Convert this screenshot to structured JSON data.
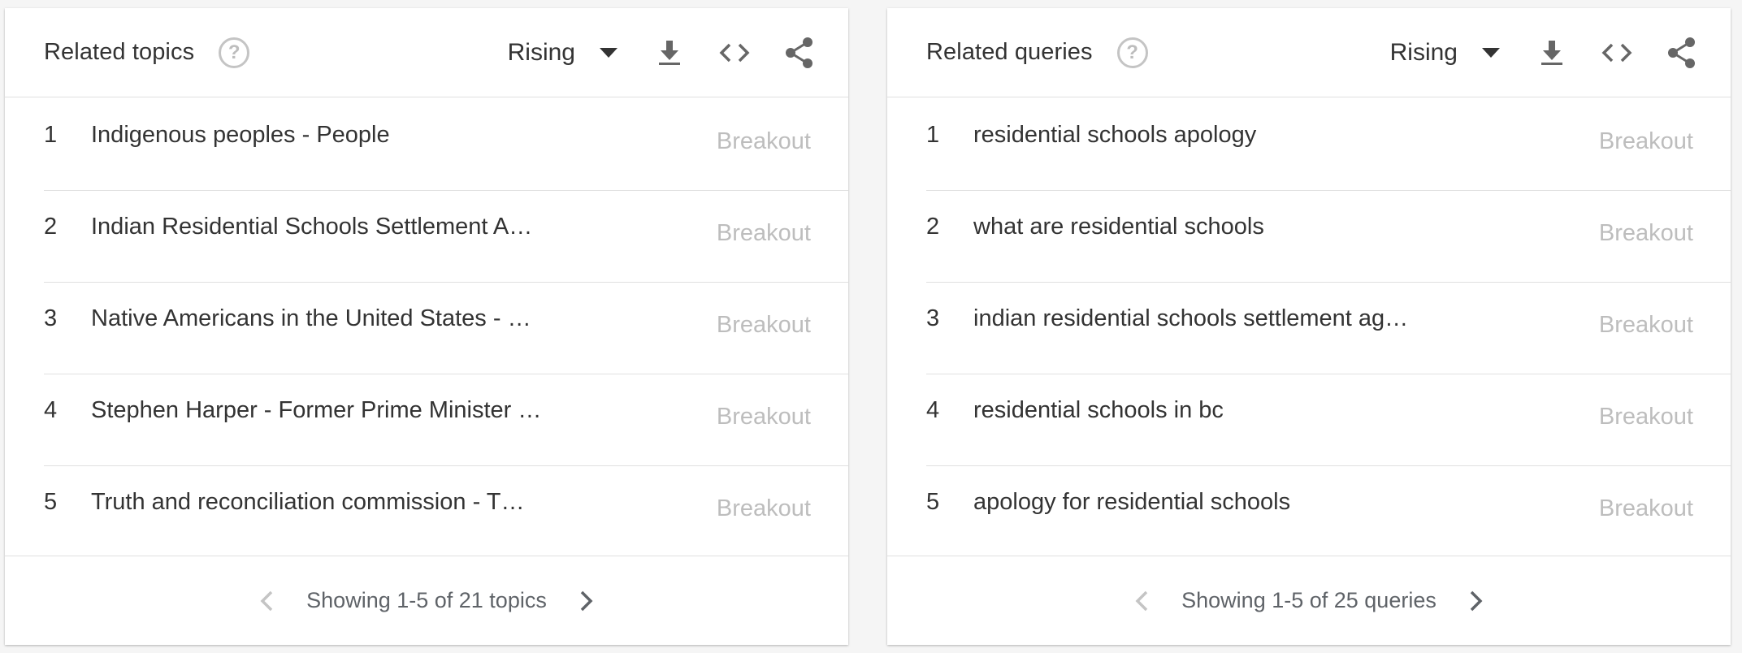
{
  "colors": {
    "icon": "#666666",
    "muted": "#bdbdbd",
    "text": "#333333",
    "divider": "#e0e0e0"
  },
  "topics": {
    "title": "Related topics",
    "help_icon": "help-circle-icon",
    "filter": "Rising",
    "icons": [
      "download-icon",
      "embed-code-icon",
      "share-icon"
    ],
    "rows": [
      {
        "rank": "1",
        "label": "Indigenous peoples - People",
        "value": "Breakout"
      },
      {
        "rank": "2",
        "label": "Indian Residential Schools Settlement A…",
        "value": "Breakout"
      },
      {
        "rank": "3",
        "label": "Native Americans in the United States - …",
        "value": "Breakout"
      },
      {
        "rank": "4",
        "label": "Stephen Harper - Former Prime Minister …",
        "value": "Breakout"
      },
      {
        "rank": "5",
        "label": "Truth and reconciliation commission - T…",
        "value": "Breakout"
      }
    ],
    "pager": "Showing 1-5 of 21 topics"
  },
  "queries": {
    "title": "Related queries",
    "help_icon": "help-circle-icon",
    "filter": "Rising",
    "icons": [
      "download-icon",
      "embed-code-icon",
      "share-icon"
    ],
    "rows": [
      {
        "rank": "1",
        "label": "residential schools apology",
        "value": "Breakout"
      },
      {
        "rank": "2",
        "label": "what are residential schools",
        "value": "Breakout"
      },
      {
        "rank": "3",
        "label": "indian residential schools settlement ag…",
        "value": "Breakout"
      },
      {
        "rank": "4",
        "label": "residential schools in bc",
        "value": "Breakout"
      },
      {
        "rank": "5",
        "label": "apology for residential schools",
        "value": "Breakout"
      }
    ],
    "pager": "Showing 1-5 of 25 queries"
  }
}
